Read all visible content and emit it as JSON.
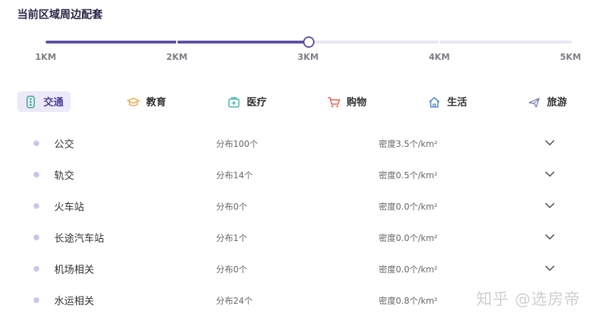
{
  "header": {
    "title": "当前区域周边配套"
  },
  "slider": {
    "ticks": [
      "1KM",
      "2KM",
      "3KM",
      "4KM",
      "5KM"
    ],
    "selected_index": 2,
    "accent": "#5b4fa3"
  },
  "tabs": [
    {
      "label": "交通",
      "icon": "traffic-light-icon",
      "active": true
    },
    {
      "label": "教育",
      "icon": "graduation-cap-icon",
      "active": false
    },
    {
      "label": "医疗",
      "icon": "medical-kit-icon",
      "active": false
    },
    {
      "label": "购物",
      "icon": "shopping-cart-icon",
      "active": false
    },
    {
      "label": "生活",
      "icon": "home-icon",
      "active": false
    },
    {
      "label": "旅游",
      "icon": "airplane-icon",
      "active": false
    }
  ],
  "list": [
    {
      "name": "公交",
      "count": "分布100个",
      "density": "密度3.5个/km²"
    },
    {
      "name": "轨交",
      "count": "分布14个",
      "density": "密度0.5个/km²"
    },
    {
      "name": "火车站",
      "count": "分布0个",
      "density": "密度0.0个/km²"
    },
    {
      "name": "长途汽车站",
      "count": "分布1个",
      "density": "密度0.0个/km²"
    },
    {
      "name": "机场相关",
      "count": "分布0个",
      "density": "密度0.0个/km²"
    },
    {
      "name": "水运相关",
      "count": "分布24个",
      "density": "密度0.8个/km²"
    }
  ],
  "watermark": "知乎 @选房帝"
}
